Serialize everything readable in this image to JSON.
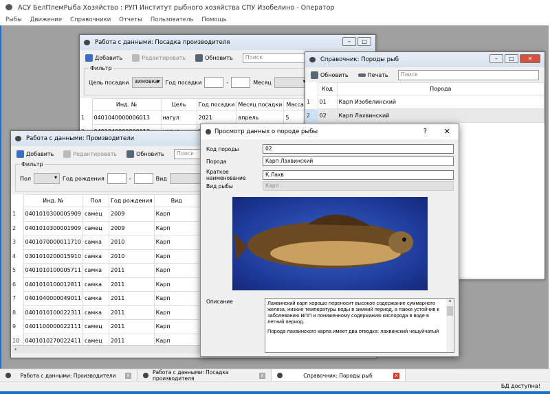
{
  "app": {
    "title": "АСУ БелПлемРыба Хозяйство : РУП Институт рыбного хозяйства СПУ Изобелино - Оператор",
    "menu": [
      "Рыбы",
      "Движение",
      "Справочники",
      "Отчеты",
      "Пользователь",
      "Помощь"
    ]
  },
  "w1": {
    "title": "Работа с данными: Посадка производителя",
    "add": "Добавить",
    "edit": "Редактировать",
    "refresh": "Обновить",
    "search_ph": "Поиск",
    "filter": "Фильтр",
    "goal_label": "Цель посадки",
    "goal_value": "зимовка",
    "year_label": "Год посадки",
    "dash": "-",
    "month_label": "Месяц",
    "cols": [
      "Инд. №",
      "Цель",
      "Год посадки",
      "Месяц посадки",
      "Масса посадки"
    ],
    "rows": [
      [
        "1",
        "0401040000006013",
        "нагул",
        "2021",
        "апрель",
        "5"
      ],
      [
        "2",
        "0401040000009013",
        "нагул",
        "2021",
        "",
        ""
      ]
    ]
  },
  "w2": {
    "title": "Работа с данными: Производители",
    "add": "Добавить",
    "edit": "Редактировать",
    "refresh": "Обновить",
    "search_ph": "Поиск",
    "filter": "Фильтр",
    "sex_label": "Пол",
    "year_label": "Год рождения",
    "dash": "-",
    "kind_label": "Вид",
    "cols": [
      "Инд. №",
      "Пол",
      "Год рождения",
      "Вид",
      ""
    ],
    "rows": [
      [
        "1",
        "0401010300005909",
        "самец",
        "2009",
        "Карп",
        "Карп"
      ],
      [
        "2",
        "0401010300001909",
        "самец",
        "2009",
        "Карп",
        "Карп"
      ],
      [
        "3",
        "0401070000011710",
        "самка",
        "2010",
        "Карп",
        "Карп"
      ],
      [
        "4",
        "0301010200015910",
        "самка",
        "2010",
        "Карп",
        "Карп"
      ],
      [
        "5",
        "0401010100005711",
        "самка",
        "2011",
        "Карп",
        "Карп"
      ],
      [
        "6",
        "0401010100012811",
        "самка",
        "2011",
        "Карп",
        "Карп"
      ],
      [
        "7",
        "0401040000049011",
        "самка",
        "2011",
        "Карп",
        "Карп"
      ],
      [
        "8",
        "0401010100022311",
        "самка",
        "2011",
        "Карп",
        "Карп"
      ],
      [
        "9",
        "0401100000022111",
        "самец",
        "2011",
        "Карп",
        "Карп"
      ],
      [
        "10",
        "0401010270022411",
        "самец",
        "2011",
        "Карп",
        "Карп"
      ]
    ]
  },
  "w3": {
    "title": "Справочник: Породы рыб",
    "refresh": "Обновить",
    "print": "Печать",
    "search_ph": "Поиск",
    "cols": [
      "Код",
      "Порода"
    ],
    "rows": [
      [
        "1",
        "01",
        "Карп Изобелинский"
      ],
      [
        "2",
        "02",
        "Карп Лахвинский"
      ]
    ]
  },
  "dialog": {
    "title": "Просмотр данных о породе рыбы",
    "help": "?",
    "close": "✕",
    "code_label": "Код породы",
    "code": "02",
    "breed_label": "Порода",
    "breed": "Карп Лахвинский",
    "short_label": "Краткое наименование",
    "short": "К.Лахв",
    "kind_label": "Вид рыбы",
    "kind": "Карп",
    "desc_label": "Описание",
    "desc": "Лахвинский карп хорошо переносит высокое содержание суммарного железа, низкие температуры воды в зимний период, а также устойчив к заболеванию ВПП и пониженному содержанию кислорода в воде в летний период.",
    "desc2": "Порода лахвинского карпа имеет два отводка: лахвинский чешуйчатый"
  },
  "tabs": [
    {
      "label": "Работа с данными: Производители"
    },
    {
      "label": "Работа с данными: Посадка производителя"
    },
    {
      "label": "Справочник: Породы рыб"
    }
  ],
  "status": "БД доступна!"
}
